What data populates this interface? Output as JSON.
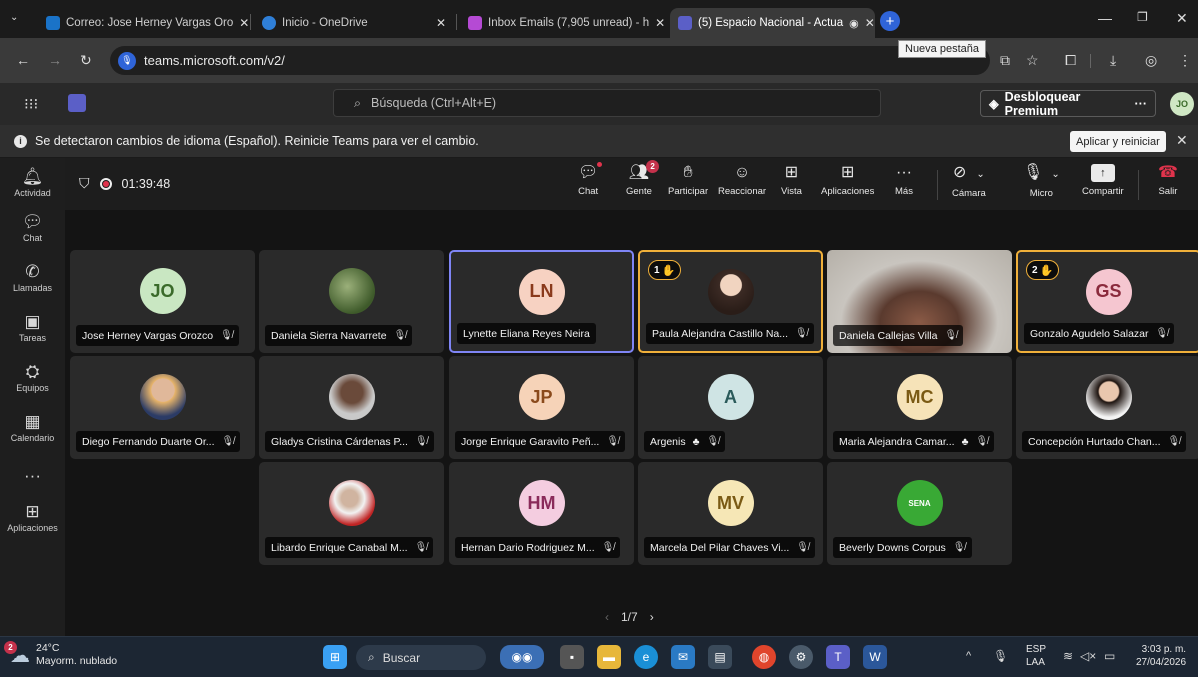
{
  "browser": {
    "tabs": [
      {
        "label": "Correo: Jose Herney Vargas Oro",
        "active": false
      },
      {
        "label": "Inicio - OneDrive",
        "active": false
      },
      {
        "label": "Inbox Emails (7,905 unread) - h",
        "active": false
      },
      {
        "label": "(5) Espacio Nacional - Actua",
        "active": true
      }
    ],
    "new_tab_tooltip": "Nueva pestaña",
    "url": "teams.microsoft.com/v2/"
  },
  "teams_header": {
    "search_placeholder": "Búsqueda (Ctrl+Alt+E)",
    "premium_label": "Desbloquear Premium",
    "more_label": "···",
    "avatar_initials": "JO"
  },
  "notification": {
    "message": "Se detectaron cambios de idioma (Español). Reinicie Teams para ver el cambio.",
    "action_label": "Aplicar y reiniciar"
  },
  "rail": {
    "items": [
      {
        "label": "Actividad",
        "icon": "bell-icon",
        "glyph": "🔔︎"
      },
      {
        "label": "Chat",
        "icon": "chat-icon",
        "glyph": "💬︎",
        "badge": "5"
      },
      {
        "label": "Llamadas",
        "icon": "phone-icon",
        "glyph": "✆"
      },
      {
        "label": "Tareas",
        "icon": "tasks-icon",
        "glyph": "▣"
      },
      {
        "label": "Equipos",
        "icon": "teams-icon",
        "glyph": "⛭"
      },
      {
        "label": "Calendario",
        "icon": "calendar-icon",
        "glyph": "▦"
      },
      {
        "label": "",
        "icon": "more-icon",
        "glyph": "···"
      },
      {
        "label": "Aplicaciones",
        "icon": "apps-icon",
        "glyph": "⊞"
      }
    ]
  },
  "meeting": {
    "elapsed": "01:39:48",
    "controls": [
      {
        "label": "Chat",
        "icon": "chat-icon",
        "glyph": "💬︎"
      },
      {
        "label": "Gente",
        "icon": "people-icon",
        "glyph": "👥︎",
        "badge": "2"
      },
      {
        "label": "Participar",
        "icon": "raise-hand-icon",
        "glyph": "✋︎"
      },
      {
        "label": "Reaccionar",
        "icon": "react-icon",
        "glyph": "☺"
      },
      {
        "label": "Vista",
        "icon": "view-icon",
        "glyph": "⊞"
      },
      {
        "label": "Aplicaciones",
        "icon": "apps-icon",
        "glyph": "⊞"
      },
      {
        "label": "Más",
        "icon": "more-icon",
        "glyph": "···"
      }
    ],
    "camera_label": "Cámara",
    "mic_label": "Micro",
    "share_label": "Compartir",
    "leave_label": "Salir",
    "pager": "1/7",
    "participants": [
      {
        "name": "Jose Herney Vargas Orozco",
        "initials": "JO",
        "bg": "#c9e7c2",
        "fg": "#3a6a2a"
      },
      {
        "name": "Daniela Sierra Navarrete",
        "photo": "plant"
      },
      {
        "name": "Lynette Eliana Reyes Neira",
        "initials": "LN",
        "bg": "#f7d2c2",
        "fg": "#8a3a1c",
        "highlight": "blue"
      },
      {
        "name": "Paula Alejandra Castillo Na...",
        "photo": "woman",
        "hand": "1",
        "highlight": "gold"
      },
      {
        "name": "Daniela Callejas Villa",
        "video": true
      },
      {
        "name": "Gonzalo Agudelo Salazar",
        "initials": "GS",
        "bg": "#f5c6d0",
        "fg": "#8a2a3c",
        "hand": "2",
        "highlight": "gold"
      },
      {
        "name": "Diego Fernando Duarte Or...",
        "photo": "man"
      },
      {
        "name": "Gladys Cristina Cárdenas P...",
        "photo": "woman2"
      },
      {
        "name": "Jorge Enrique Garavito Peñ...",
        "initials": "JP",
        "bg": "#f6d3b8",
        "fg": "#8a4a1c"
      },
      {
        "name": "Argenis",
        "initials": "A",
        "bg": "#cfe4e4",
        "fg": "#2a5a5a",
        "status": "♣"
      },
      {
        "name": "Maria Alejandra Camar...",
        "initials": "MC",
        "bg": "#f6e3b8",
        "fg": "#7a5a14",
        "status": "♣"
      },
      {
        "name": "Concepción Hurtado Chan...",
        "photo": "woman3"
      },
      {
        "name": "Libardo Enrique Canabal M...",
        "photo": "group"
      },
      {
        "name": "Hernan Dario Rodriguez M...",
        "initials": "HM",
        "bg": "#f4cde0",
        "fg": "#8a2a5a"
      },
      {
        "name": "Marcela Del Pilar Chaves Vi...",
        "initials": "MV",
        "bg": "#f6e7b6",
        "fg": "#7a5a14"
      },
      {
        "name": "Beverly Downs Corpus",
        "photo": "sena"
      }
    ]
  },
  "taskbar": {
    "weather_temp": "24°C",
    "weather_desc": "Mayorm. nublado",
    "weather_badge": "2",
    "search_label": "Buscar",
    "lang_top": "ESP",
    "lang_bottom": "LAA",
    "time": "3:03 p. m.",
    "date": "27/04/2026"
  }
}
